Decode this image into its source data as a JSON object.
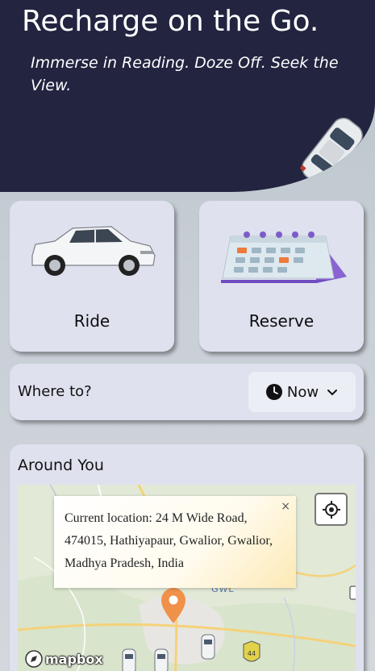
{
  "hero": {
    "title": "Recharge on the Go.",
    "subtitle": "Immerse in Reading. Doze Off. Seek the View.",
    "bg_color": "#222440"
  },
  "options": {
    "ride_label": "Ride",
    "reserve_label": "Reserve"
  },
  "where": {
    "label": "Where to?",
    "time_value": "Now"
  },
  "around": {
    "title": "Around You",
    "popup_text": "Current location: 24 M Wide Road, 474015, Hathiyapaur, Gwalior, Gwalior, Madhya Pradesh, India",
    "close_symbol": "×",
    "map_label": "GWL",
    "road_shield": "44",
    "attribution": "mapbox",
    "marker_color": "#f0914a"
  }
}
